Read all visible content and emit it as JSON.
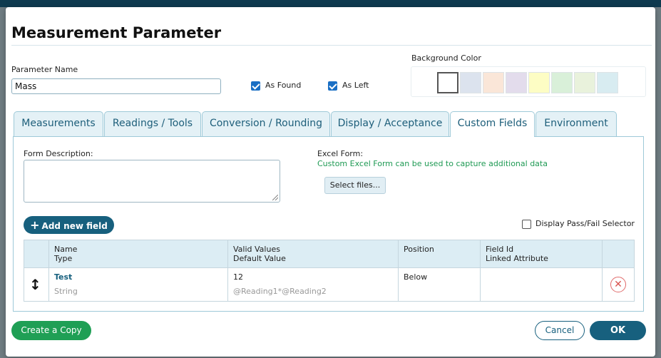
{
  "dialog": {
    "title": "Measurement Parameter"
  },
  "form": {
    "param_name_label": "Parameter Name",
    "param_name_value": "Mass",
    "as_found_label": "As Found",
    "as_found_checked": true,
    "as_left_label": "As Left",
    "as_left_checked": true,
    "bg_color_label": "Background Color",
    "bg_colors": [
      "#ffffff",
      "#dce3ee",
      "#fae6d8",
      "#e3dcec",
      "#fdfdc4",
      "#d9f0d9",
      "#e9f2dc",
      "#d8ecf1"
    ]
  },
  "tabs": [
    {
      "label": "Measurements"
    },
    {
      "label": "Readings / Tools"
    },
    {
      "label": "Conversion / Rounding"
    },
    {
      "label": "Display / Acceptance"
    },
    {
      "label": "Custom Fields",
      "active": true
    },
    {
      "label": "Environment"
    }
  ],
  "custom_fields": {
    "form_description_label": "Form Description:",
    "excel_form_label": "Excel Form:",
    "excel_form_hint": "Custom Excel Form can be used to capture additional data",
    "select_files_label": "Select files...",
    "add_field_label": "Add new field",
    "pass_fail_label": "Display Pass/Fail Selector",
    "pass_fail_checked": false,
    "columns": {
      "name": "Name",
      "type": "Type",
      "valid_values": "Valid Values",
      "default_value": "Default Value",
      "position": "Position",
      "field_id": "Field Id",
      "linked_attribute": "Linked Attribute"
    },
    "rows": [
      {
        "name": "Test",
        "type": "String",
        "valid_values": "12",
        "default_value": "@Reading1*@Reading2",
        "position": "Below"
      }
    ]
  },
  "footer": {
    "copy_label": "Create a Copy",
    "cancel_label": "Cancel",
    "ok_label": "OK"
  },
  "icons": {
    "drag_handle": "drag-handle-icon",
    "delete": "delete-circle-icon",
    "add": "plus-icon"
  }
}
